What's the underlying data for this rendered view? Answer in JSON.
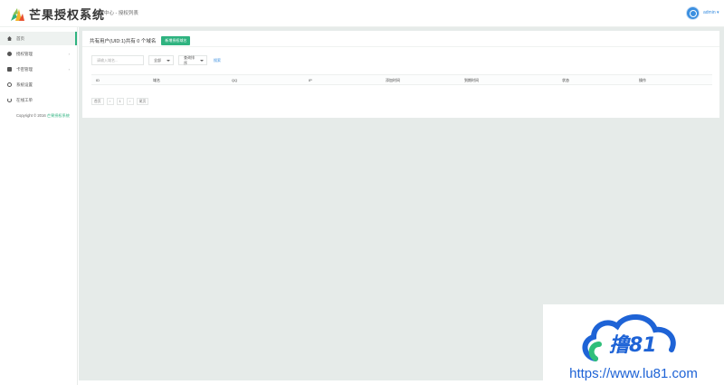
{
  "header": {
    "app_title": "芒果授权系统",
    "breadcrumb": "用户中心 - 授权列表",
    "user_name": "admin ▾"
  },
  "sidebar": {
    "items": [
      {
        "label": "首页",
        "icon": "home-icon",
        "active": true
      },
      {
        "label": "授权管理",
        "icon": "disc-icon",
        "has_arrow": true
      },
      {
        "label": "卡密管理",
        "icon": "card-icon",
        "has_arrow": true
      },
      {
        "label": "系统设置",
        "icon": "gear-icon"
      },
      {
        "label": "在线工单",
        "icon": "ticket-icon"
      }
    ],
    "arrow": "›",
    "copyright_prefix": "Copyright © 2016 ",
    "copyright_link": "芒果授权系统"
  },
  "main": {
    "card_title": "共有用户(UID:1)共有 0 个域名",
    "add_button": "新增授权域名",
    "search_placeholder": "请输入域名...",
    "select_type": "全部",
    "select_sort": "查询排序",
    "search_button": "搜索",
    "columns": [
      "ID",
      "域名",
      "QQ",
      "IP",
      "添加时间",
      "到期时间",
      "状态",
      "操作"
    ],
    "pager": [
      "首页",
      "‹",
      "1",
      "›",
      "尾页"
    ]
  },
  "watermark": {
    "brand": "撸81",
    "url": "https://www.lu81.com"
  },
  "colors": {
    "accent_green": "#2fb380",
    "link_blue": "#3b8fe0",
    "main_bg": "#e6ebe9",
    "watermark_blue": "#1e63d6"
  }
}
